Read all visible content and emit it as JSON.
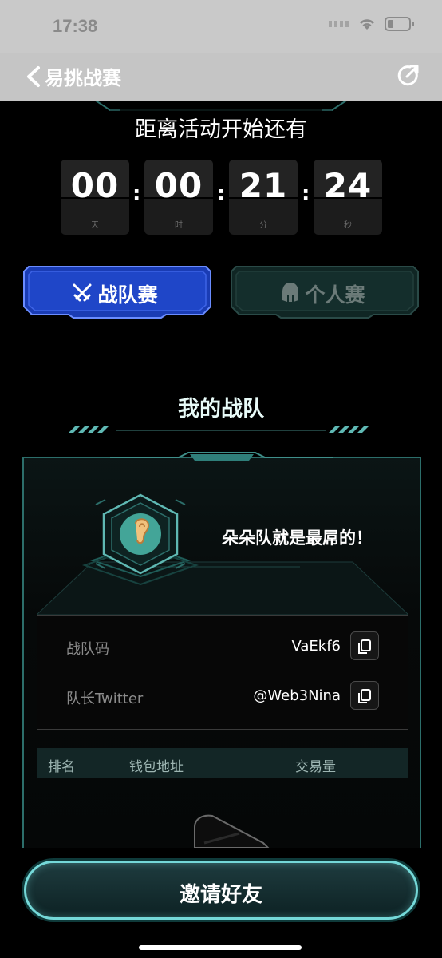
{
  "status_bar": {
    "time": "17:38"
  },
  "nav": {
    "title": "易挑战赛",
    "back_icon": "chevron-left-icon",
    "share_icon": "share-icon"
  },
  "countdown": {
    "title": "距离活动开始还有",
    "days": "00",
    "days_unit": "天",
    "hours": "00",
    "hours_unit": "时",
    "minutes": "21",
    "minutes_unit": "分",
    "seconds": "24",
    "seconds_unit": "秒"
  },
  "tabs": {
    "team": {
      "label": "战队赛",
      "icon": "crossed-swords-icon",
      "active": true,
      "color": "#1f46c8"
    },
    "solo": {
      "label": "个人赛",
      "icon": "spartan-helmet-icon",
      "active": false
    }
  },
  "team_section": {
    "title": "我的战队",
    "team_name": "朵朵队就是最屌的！",
    "emblem_icon": "ear-icon",
    "team_code_label": "战队码",
    "team_code_value": "VaEkf6",
    "captain_label": "队长Twitter",
    "captain_value": "@Web3Nina"
  },
  "table": {
    "col_rank": "排名",
    "col_wallet": "钱包地址",
    "col_volume": "交易量"
  },
  "invite": {
    "label": "邀请好友"
  },
  "colors": {
    "accent": "#74d8d8",
    "card_border": "#2c6e6a",
    "tab_active": "#1f46c8"
  }
}
